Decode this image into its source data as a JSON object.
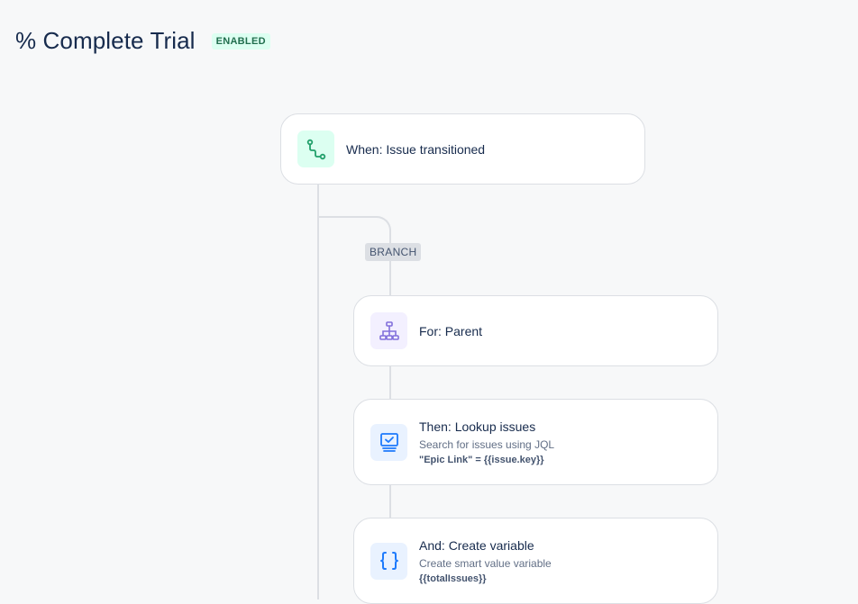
{
  "header": {
    "title": "% Complete Trial",
    "status": "ENABLED"
  },
  "flow": {
    "trigger": {
      "icon": "transition-path-icon",
      "title": "When: Issue transitioned"
    },
    "branch_label": "BRANCH",
    "branch_for": {
      "icon": "hierarchy-icon",
      "title": "For: Parent"
    },
    "lookup": {
      "icon": "lookup-monitor-icon",
      "title": "Then: Lookup issues",
      "subtitle": "Search for issues using JQL",
      "code": "\"Epic Link\" = {{issue.key}}"
    },
    "create_variable": {
      "icon": "curly-braces-icon",
      "title": "And: Create variable",
      "subtitle": "Create smart value variable",
      "code": "{{totalIssues}}"
    }
  },
  "colors": {
    "background": "#f7f8f9",
    "connector": "#dcdfe4",
    "green_icon": "#22a06b",
    "purple_icon": "#8270db",
    "blue_icon": "#1d7afc"
  }
}
